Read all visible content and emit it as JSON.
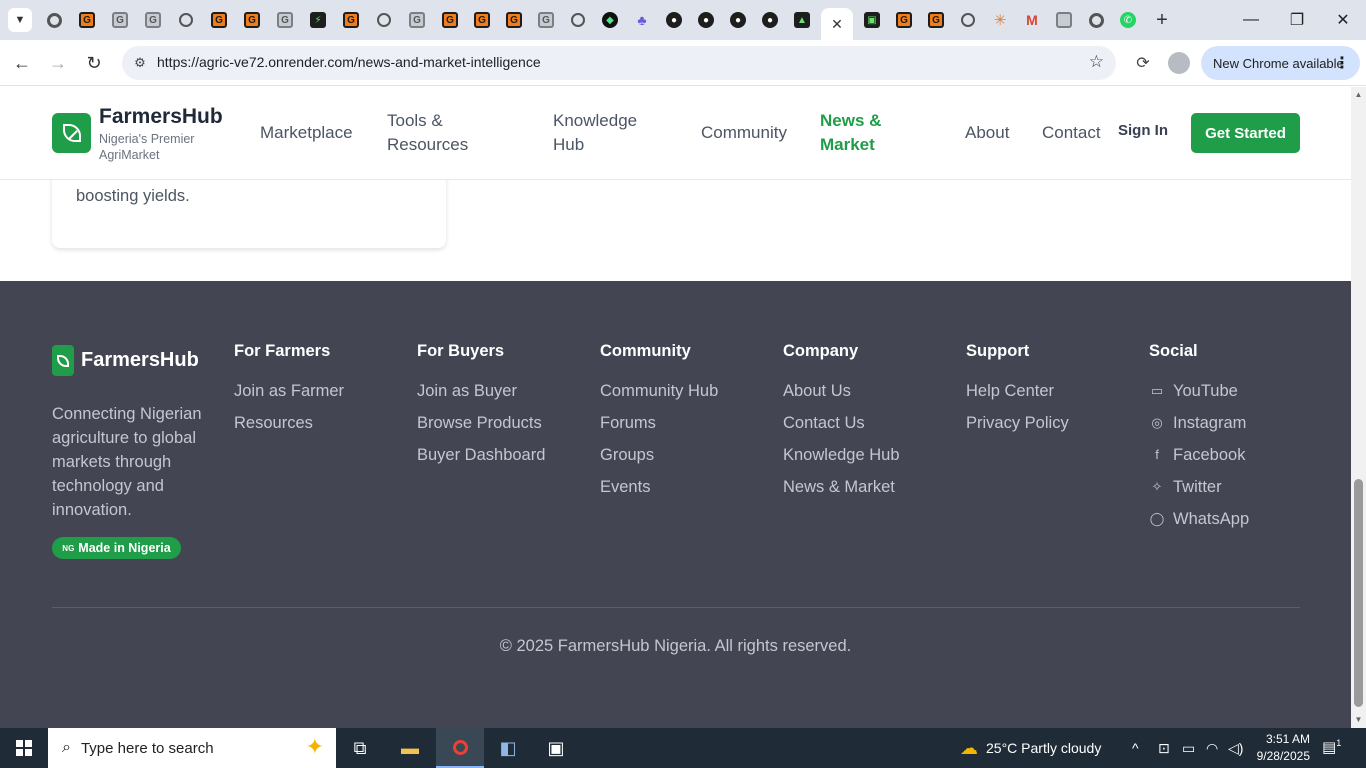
{
  "browser": {
    "url": "https://agric-ve72.onrender.com/news-and-market-intelligence",
    "update_label": "New Chrome available"
  },
  "site": {
    "brand": "FarmersHub",
    "brand_tagline": "Nigeria's Premier AgriMarket",
    "nav": {
      "marketplace": "Marketplace",
      "tools": "Tools & Resources",
      "knowledge": "Knowledge Hub",
      "community": "Community",
      "news": "News & Market",
      "about": "About",
      "contact": "Contact"
    },
    "sign_in": "Sign In",
    "get_started": "Get Started",
    "card_text": "boosting yields."
  },
  "footer": {
    "brand": "FarmersHub",
    "description": "Connecting Nigerian agriculture to global markets through technology and innovation.",
    "badge_flag": "NG",
    "badge": "Made in Nigeria",
    "columns": [
      {
        "title": "For Farmers",
        "links": [
          "Join as Farmer",
          "Resources"
        ]
      },
      {
        "title": "For Buyers",
        "links": [
          "Join as Buyer",
          "Browse Products",
          "Buyer Dashboard"
        ]
      },
      {
        "title": "Community",
        "links": [
          "Community Hub",
          "Forums",
          "Groups",
          "Events"
        ]
      },
      {
        "title": "Company",
        "links": [
          "About Us",
          "Contact Us",
          "Knowledge Hub",
          "News & Market"
        ]
      },
      {
        "title": "Support",
        "links": [
          "Help Center",
          "Privacy Policy"
        ]
      },
      {
        "title": "Social",
        "links": [
          "YouTube",
          "Instagram",
          "Facebook",
          "Twitter",
          "WhatsApp"
        ]
      }
    ],
    "copyright": "© 2025 FarmersHub Nigeria. All rights reserved."
  },
  "taskbar": {
    "search_placeholder": "Type here to search",
    "weather": "25°C  Partly cloudy",
    "time": "3:51 AM",
    "date": "9/28/2025",
    "notification_count": "1"
  },
  "colors": {
    "brand_green": "#1f9d48",
    "footer_bg": "#434552",
    "taskbar_bg": "#1f2b36"
  }
}
